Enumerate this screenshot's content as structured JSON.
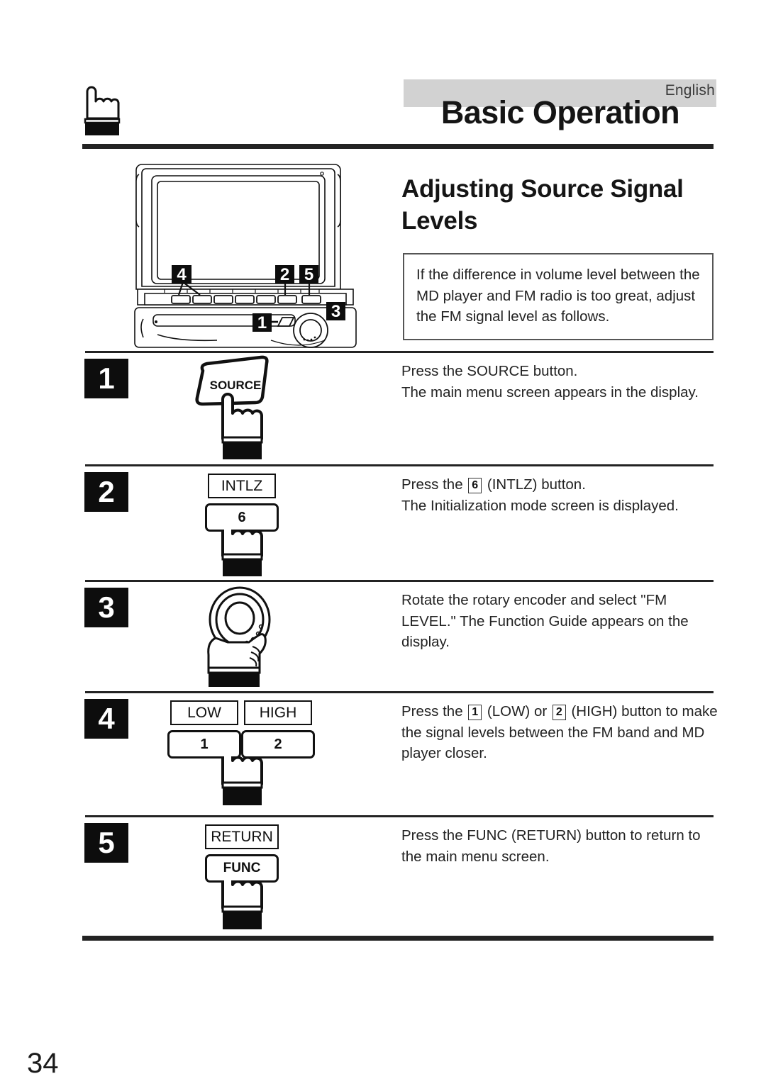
{
  "header": {
    "language": "English",
    "title": "Basic Operation",
    "hand_icon": "pointing-hand-icon"
  },
  "section": {
    "title": "Adjusting Source Signal Levels",
    "intro": "If the difference in volume level between the MD player and FM radio is too great, adjust the FM signal level as follows."
  },
  "device_illustration": {
    "name": "car-stereo-front-panel",
    "callouts": [
      "4",
      "2",
      "5",
      "3",
      "1"
    ]
  },
  "steps": [
    {
      "number": "1",
      "art": "source-button-with-pressing-hand",
      "key_label": "SOURCE",
      "text_lines": [
        "Press the SOURCE button.",
        "The main menu screen appears in the display."
      ]
    },
    {
      "number": "2",
      "art": "intlz-key-with-pressing-hand",
      "chip_label": "INTLZ",
      "key_label": "6",
      "text_pre": "Press the ",
      "text_key": "6",
      "text_post": " (INTLZ) button.",
      "text_line2": "The Initialization mode screen is displayed."
    },
    {
      "number": "3",
      "art": "rotary-encoder-with-grasping-hand",
      "text_lines": [
        "Rotate the rotary encoder and select \"FM LEVEL.\" The Function Guide appears on the display."
      ]
    },
    {
      "number": "4",
      "art": "low-high-keys-with-pressing-hand",
      "chip_label_left": "LOW",
      "chip_label_right": "HIGH",
      "key_label_left": "1",
      "key_label_right": "2",
      "text_pre": "Press the ",
      "text_key1": "1",
      "text_mid": " (LOW) or ",
      "text_key2": "2",
      "text_post": " (HIGH) button to make the signal levels between the FM band and MD player closer."
    },
    {
      "number": "5",
      "art": "func-key-with-pressing-hand",
      "chip_label": "RETURN",
      "key_label": "FUNC",
      "text_lines": [
        "Press the FUNC (RETURN) button to return to the main menu screen."
      ]
    }
  ],
  "footer": {
    "page_number": "34"
  }
}
